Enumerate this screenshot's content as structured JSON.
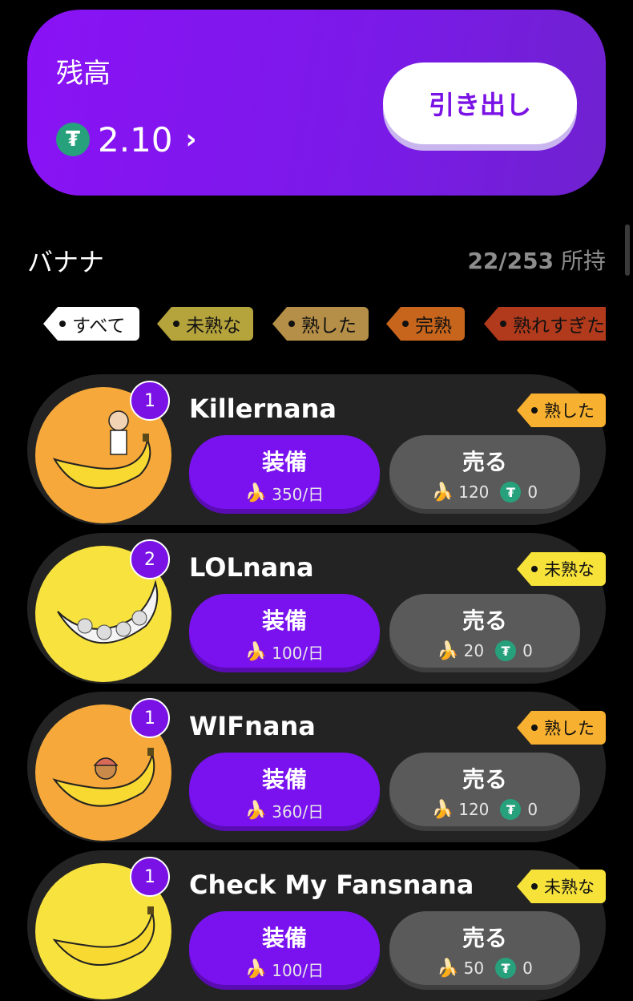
{
  "balance": {
    "label": "残高",
    "currency_icon": "tether-icon",
    "amount": "2.10",
    "chevron": "›",
    "withdraw_label": "引き出し"
  },
  "section": {
    "title": "バナナ",
    "owned_count": "22/253",
    "owned_suffix": "所持"
  },
  "filters": [
    {
      "label": "すべて",
      "selected": true,
      "color": "#ffffff"
    },
    {
      "label": "未熟な",
      "selected": false,
      "color": "#b5a33c"
    },
    {
      "label": "熟した",
      "selected": false,
      "color": "#b58e47"
    },
    {
      "label": "完熟",
      "selected": false,
      "color": "#c7651c"
    },
    {
      "label": "熟れすぎた",
      "selected": false,
      "color": "#b23a1c"
    }
  ],
  "bananas": [
    {
      "name": "Killernana",
      "badge": "1",
      "grade": "熟した",
      "grade_color": "#f7b02f",
      "disc_color": "#f6a93a",
      "equip_label": "装備",
      "equip_rate": "350/日",
      "sell_label": "売る",
      "sell_banana": "120",
      "sell_tether": "0"
    },
    {
      "name": "LOLnana",
      "badge": "2",
      "grade": "未熟な",
      "grade_color": "#f7e23a",
      "disc_color": "#f8e23d",
      "equip_label": "装備",
      "equip_rate": "100/日",
      "sell_label": "売る",
      "sell_banana": "20",
      "sell_tether": "0"
    },
    {
      "name": "WIFnana",
      "badge": "1",
      "grade": "熟した",
      "grade_color": "#f7b02f",
      "disc_color": "#f6a93a",
      "equip_label": "装備",
      "equip_rate": "360/日",
      "sell_label": "売る",
      "sell_banana": "120",
      "sell_tether": "0"
    },
    {
      "name": "Check My Fansnana",
      "badge": "1",
      "grade": "未熟な",
      "grade_color": "#f7e23a",
      "disc_color": "#f8e23d",
      "equip_label": "装備",
      "equip_rate": "100/日",
      "sell_label": "売る",
      "sell_banana": "50",
      "sell_tether": "0"
    }
  ],
  "colors": {
    "accent": "#7a12f0",
    "tether": "#26a17b",
    "background": "#000000"
  }
}
